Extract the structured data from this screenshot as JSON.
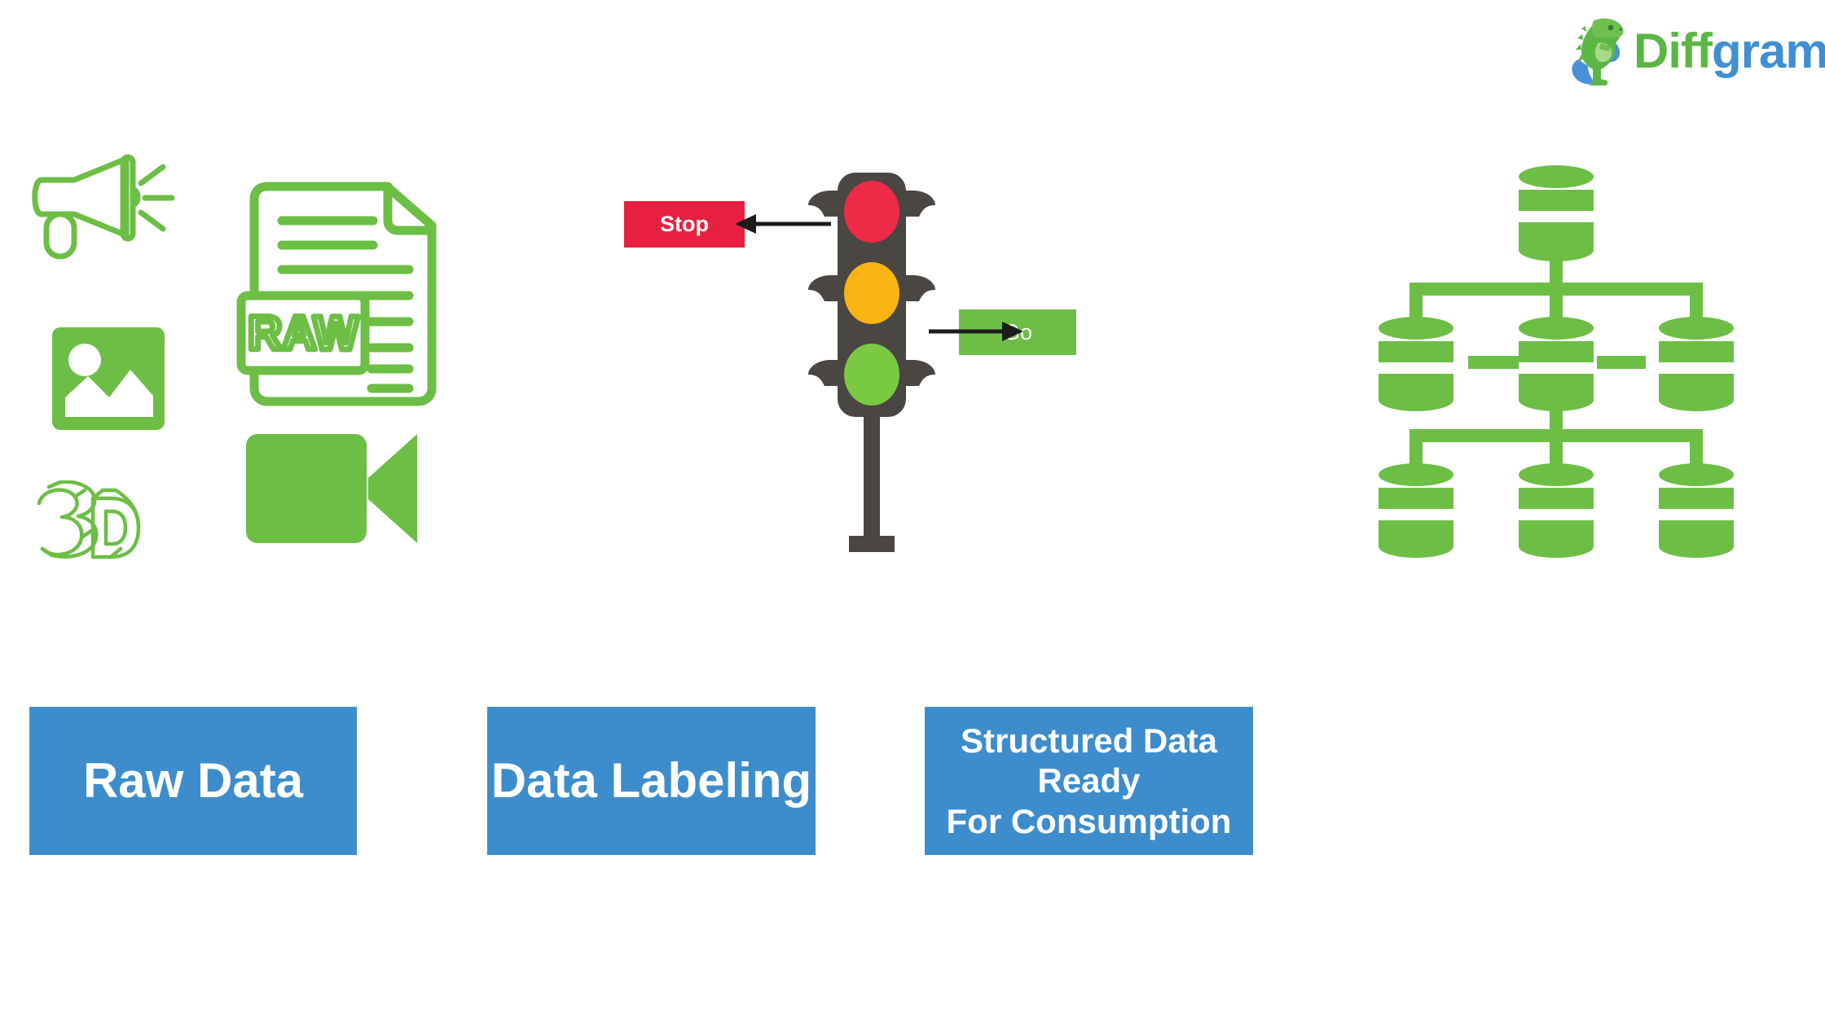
{
  "brand": {
    "name_part_1": "Diff",
    "name_part_2": "gram",
    "mascot_icon": "dinosaur-icon",
    "green": "#5CB646",
    "blue": "#3F8FD2"
  },
  "colors": {
    "green": "#6CBE45",
    "blue": "#3D8DCC",
    "red": "#E8203F",
    "amber": "#F9B313",
    "traffic_light_body": "#4A4641",
    "arrow": "#1C1C1C",
    "background": "#FFFFFF"
  },
  "columns": [
    {
      "id": "raw-data",
      "banner_label": "Raw Data",
      "icons": [
        {
          "name": "megaphone-icon",
          "label": "Audio"
        },
        {
          "name": "image-icon",
          "label": "Image"
        },
        {
          "name": "3d-icon",
          "label": "3D"
        },
        {
          "name": "raw-document-icon",
          "label": "RAW"
        },
        {
          "name": "video-camera-icon",
          "label": "Video"
        }
      ],
      "raw_badge_text": "RAW"
    },
    {
      "id": "data-labeling",
      "banner_label": "Data Labeling",
      "traffic_light": {
        "lights": [
          {
            "name": "red-light",
            "color": "#E8203F",
            "label": "Stop"
          },
          {
            "name": "amber-light",
            "color": "#F9B313",
            "label": ""
          },
          {
            "name": "green-light",
            "color": "#7AC943",
            "label": "Go"
          }
        ],
        "annotations": [
          {
            "name": "stop-annotation",
            "text": "Stop",
            "box_color": "#E8203F",
            "arrow_direction": "left"
          },
          {
            "name": "go-annotation",
            "text": "Go",
            "box_color": "#6CBE45",
            "arrow_direction": "right"
          }
        ]
      }
    },
    {
      "id": "structured-data",
      "banner_label_line_1": "Structured Data Ready",
      "banner_label_line_2": "For Consumption",
      "database_tree": {
        "root_count": 1,
        "middle_row_count": 3,
        "bottom_row_count": 3,
        "node_icon": "database-cylinder-icon"
      }
    }
  ]
}
